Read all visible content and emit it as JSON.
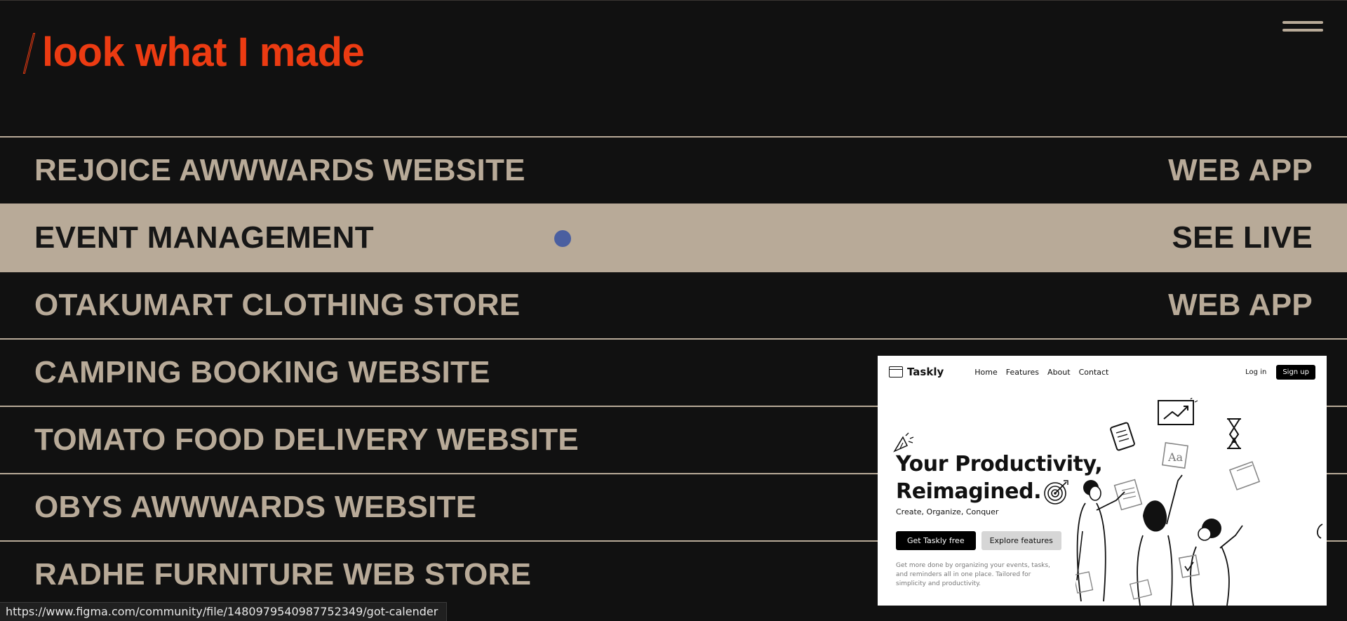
{
  "header": {
    "title": "look what I made",
    "accent_color": "#ec3b12",
    "menu_icon": "hamburger-icon"
  },
  "projects": [
    {
      "name": "REJOICE AWWWARDS WEBSITE",
      "tag": "WEB APP"
    },
    {
      "name": "EVENT MANAGEMENT",
      "tag": "SEE LIVE"
    },
    {
      "name": "OTAKUMART CLOTHING STORE",
      "tag": "WEB APP"
    },
    {
      "name": "CAMPING BOOKING WEBSITE",
      "tag": ""
    },
    {
      "name": "TOMATO FOOD DELIVERY WEBSITE",
      "tag": ""
    },
    {
      "name": "OBYS AWWWARDS WEBSITE",
      "tag": ""
    },
    {
      "name": "RADHE FURNITURE WEB STORE",
      "tag": ""
    }
  ],
  "preview": {
    "brand": "Taskly",
    "nav_links": [
      "Home",
      "Features",
      "About",
      "Contact"
    ],
    "login": "Log in",
    "signup": "Sign up",
    "headline_line1": "Your Productivity,",
    "headline_line2": "Reimagined.",
    "subheadline": "Create, Organize, Conquer",
    "primary_button": "Get Taskly  free",
    "secondary_button": "Explore features",
    "description": "Get more done by organizing your events, tasks, and reminders all in one place. Tailored for simplicity and productivity."
  },
  "status_url": "https://www.figma.com/community/file/1480979540987752349/got-calender",
  "colors": {
    "background": "#111111",
    "row_text": "#b8aa98",
    "active_row_bg": "#b8aa98",
    "cursor_dot": "#4a5fa0"
  }
}
